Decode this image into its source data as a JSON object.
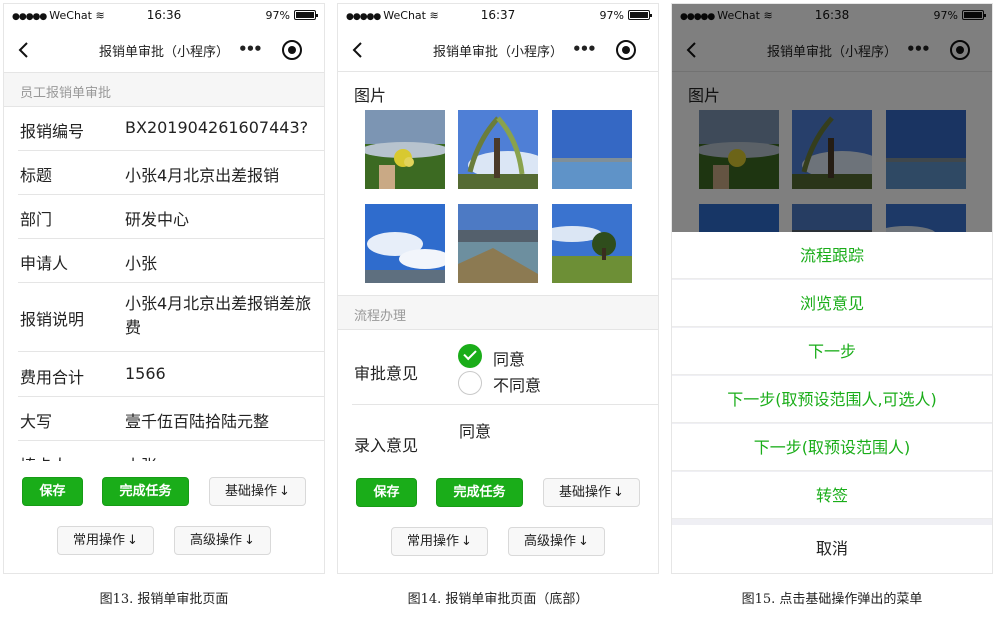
{
  "status": {
    "carrier": "WeChat",
    "dots": "●●●●●",
    "battery": "97%",
    "times": [
      "16:36",
      "16:37",
      "16:38"
    ]
  },
  "nav": {
    "title": "报销单审批（小程序）",
    "more": "•••"
  },
  "screen1": {
    "section": "员工报销单审批",
    "fields": [
      {
        "k": "报销编号",
        "v": "BX201904261607443?"
      },
      {
        "k": "标题",
        "v": "小张4月北京出差报销"
      },
      {
        "k": "部门",
        "v": "研发中心"
      },
      {
        "k": "申请人",
        "v": "小张"
      },
      {
        "k": "报销说明",
        "v": "小张4月北京出差报销差旅费"
      },
      {
        "k": "费用合计",
        "v": "1566"
      },
      {
        "k": "大写",
        "v": "壹千伍百陆拾陆元整"
      },
      {
        "k": "填卡人",
        "v": "小张"
      }
    ]
  },
  "buttons": {
    "save": "保存",
    "complete": "完成任务",
    "basic": "基础操作",
    "common": "常用操作",
    "advanced": "高级操作",
    "arrow": "↓"
  },
  "screen2": {
    "pictures_label": "图片",
    "process_section": "流程办理",
    "opinion_label": "审批意见",
    "agree": "同意",
    "disagree": "不同意",
    "input_label": "录入意见",
    "input_value": "同意"
  },
  "screen3": {
    "menu": [
      "流程跟踪",
      "浏览意见",
      "下一步",
      "下一步(取预设范围人,可选人)",
      "下一步(取预设范围人)",
      "转签"
    ],
    "cancel": "取消"
  },
  "captions": [
    "图13. 报销单审批页面",
    "图14. 报销单审批页面（底部）",
    "图15. 点击基础操作弹出的菜单"
  ],
  "colors": {
    "accent": "#1aad19",
    "mask": "rgba(0,0,0,0.5)"
  }
}
